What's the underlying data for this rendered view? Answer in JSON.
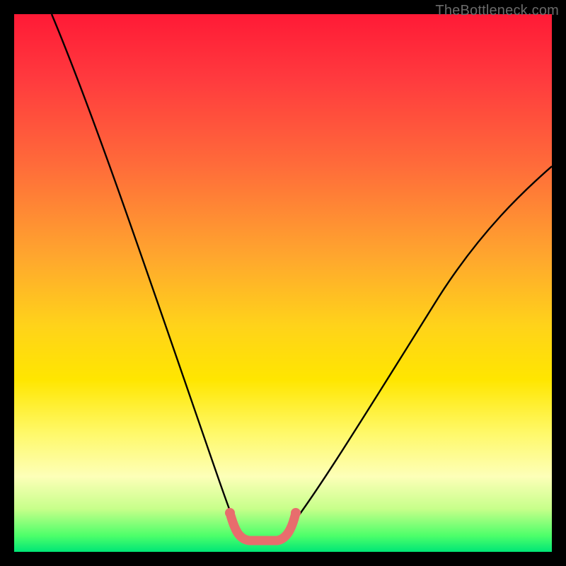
{
  "watermark": "TheBottleneck.com",
  "chart_data": {
    "type": "line",
    "title": "",
    "xlabel": "",
    "ylabel": "",
    "xlim": [
      0,
      100
    ],
    "ylim": [
      0,
      100
    ],
    "grid": false,
    "legend": false,
    "series": [
      {
        "name": "left-curve",
        "x": [
          7,
          12,
          18,
          24,
          30,
          35,
          38,
          40,
          41,
          42
        ],
        "values": [
          100,
          86,
          70,
          54,
          37,
          22,
          13,
          7,
          4,
          3
        ]
      },
      {
        "name": "right-curve",
        "x": [
          50,
          54,
          60,
          68,
          78,
          90,
          100
        ],
        "values": [
          3,
          6,
          13,
          24,
          40,
          58,
          72
        ]
      }
    ],
    "highlight": {
      "name": "bottleneck-marker",
      "color": "#e86d6d",
      "x": [
        40,
        41,
        43,
        46,
        49,
        51,
        52
      ],
      "values": [
        6.8,
        3.4,
        2.2,
        2.0,
        2.2,
        3.4,
        6.8
      ]
    },
    "gradient_stops": [
      {
        "pos": 0.0,
        "color": "#ff1a36"
      },
      {
        "pos": 0.5,
        "color": "#ffe600"
      },
      {
        "pos": 0.92,
        "color": "#c7ff8a"
      },
      {
        "pos": 1.0,
        "color": "#00e676"
      }
    ]
  }
}
